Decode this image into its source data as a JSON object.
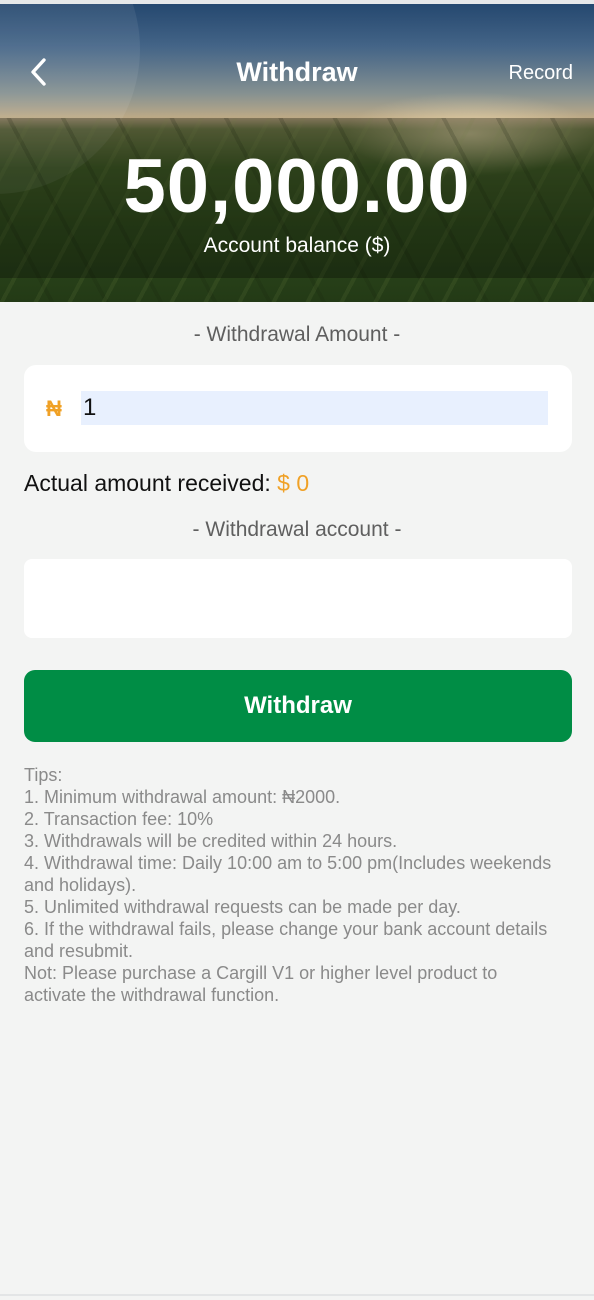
{
  "header": {
    "title": "Withdraw",
    "record_label": "Record",
    "back_icon": "chevron-left-icon"
  },
  "balance": {
    "amount": "50,000.00",
    "label": "Account balance ($)"
  },
  "withdrawal_amount": {
    "section_label": "- Withdrawal Amount -",
    "currency_symbol": "₦",
    "value": "1",
    "placeholder": ""
  },
  "actual_received": {
    "label": "Actual amount received: ",
    "value": "$ 0"
  },
  "withdrawal_account": {
    "section_label": "- Withdrawal account -",
    "value": ""
  },
  "withdraw_button": {
    "label": "Withdraw"
  },
  "tips": [
    "Tips:",
    "1. Minimum withdrawal amount: ₦2000.",
    "2. Transaction fee: 10%",
    "3. Withdrawals will be credited within 24 hours.",
    "4. Withdrawal time: Daily 10:00 am to 5:00 pm(Includes weekends and holidays).",
    "5. Unlimited withdrawal requests can be made per day.",
    "6. If the withdrawal fails, please change your bank account details and resubmit.",
    "Not: Please purchase a Cargill V1 or higher level product to activate the withdrawal function."
  ],
  "colors": {
    "accent_orange": "#f0a126",
    "button_green": "#008d45",
    "page_background": "#f3f4f3"
  }
}
